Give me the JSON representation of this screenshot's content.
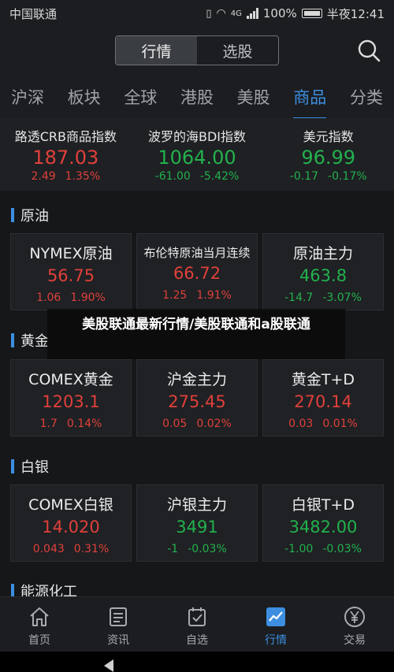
{
  "status_bar": {
    "carrier": "中国联通",
    "network": "4G",
    "battery": "100%",
    "time": "半夜12:41"
  },
  "header": {
    "segments": [
      "行情",
      "选股"
    ],
    "active_segment": "行情"
  },
  "tabs": [
    {
      "label": "沪深",
      "active": false
    },
    {
      "label": "板块",
      "active": false
    },
    {
      "label": "全球",
      "active": false
    },
    {
      "label": "港股",
      "active": false
    },
    {
      "label": "美股",
      "active": false
    },
    {
      "label": "商品",
      "active": true
    },
    {
      "label": "分类",
      "active": false
    }
  ],
  "indices": [
    {
      "name": "路透CRB商品指数",
      "value": "187.03",
      "change": "2.49",
      "pct": "1.35%",
      "trend": "up"
    },
    {
      "name": "波罗的海BDI指数",
      "value": "1064.00",
      "change": "-61.00",
      "pct": "-5.42%",
      "trend": "down"
    },
    {
      "name": "美元指数",
      "value": "96.99",
      "change": "-0.17",
      "pct": "-0.17%",
      "trend": "down"
    }
  ],
  "sections": [
    {
      "title": "原油",
      "items": [
        {
          "name": "NYMEX原油",
          "value": "56.75",
          "change": "1.06",
          "pct": "1.90%",
          "trend": "up"
        },
        {
          "name": "布伦特原油当月连续",
          "value": "66.72",
          "change": "1.25",
          "pct": "1.91%",
          "trend": "up"
        },
        {
          "name": "原油主力",
          "value": "463.8",
          "change": "-14.7",
          "pct": "-3.07%",
          "trend": "down"
        }
      ]
    },
    {
      "title": "黄金",
      "items": [
        {
          "name": "COMEX黄金",
          "value": "1203.1",
          "change": "1.7",
          "pct": "0.14%",
          "trend": "up"
        },
        {
          "name": "沪金主力",
          "value": "275.45",
          "change": "0.05",
          "pct": "0.02%",
          "trend": "up"
        },
        {
          "name": "黄金T+D",
          "value": "270.14",
          "change": "0.03",
          "pct": "0.01%",
          "trend": "up"
        }
      ]
    },
    {
      "title": "白银",
      "items": [
        {
          "name": "COMEX白银",
          "value": "14.020",
          "change": "0.043",
          "pct": "0.31%",
          "trend": "up"
        },
        {
          "name": "沪银主力",
          "value": "3491",
          "change": "-1",
          "pct": "-0.03%",
          "trend": "down"
        },
        {
          "name": "白银T+D",
          "value": "3482.00",
          "change": "-1.00",
          "pct": "-0.03%",
          "trend": "down"
        }
      ]
    },
    {
      "title": "能源化工",
      "items": []
    }
  ],
  "banner": "美股联通最新行情/美股联通和a股联通",
  "bottom_nav": [
    {
      "label": "首页",
      "icon": "home-icon",
      "active": false
    },
    {
      "label": "资讯",
      "icon": "news-icon",
      "active": false
    },
    {
      "label": "自选",
      "icon": "watchlist-icon",
      "active": false
    },
    {
      "label": "行情",
      "icon": "market-chart-icon",
      "active": true
    },
    {
      "label": "交易",
      "icon": "yen-trade-icon",
      "active": false
    }
  ],
  "colors": {
    "up": "#e0403a",
    "down": "#23b14d",
    "accent": "#3d8ee0"
  }
}
